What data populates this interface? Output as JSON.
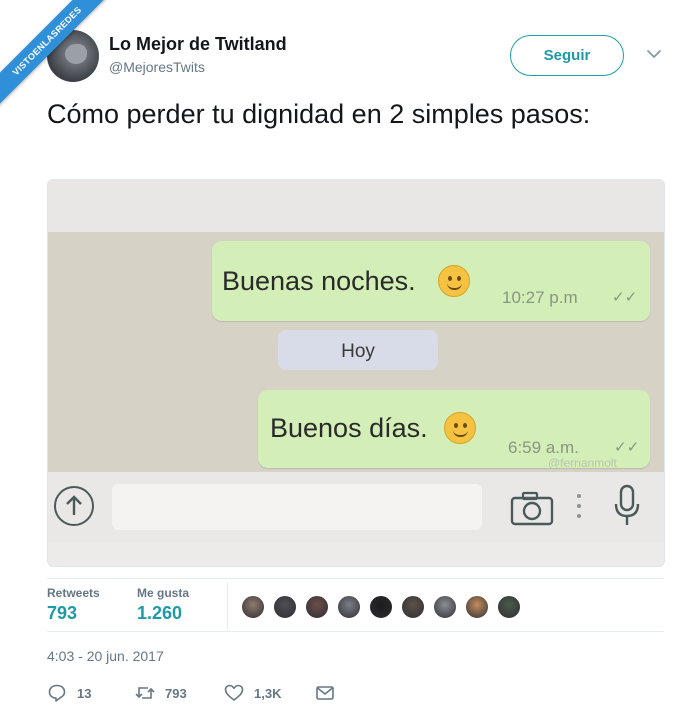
{
  "ribbon": {
    "text": "VISTOENLASREDES"
  },
  "header": {
    "name": "Lo Mejor de Twitland",
    "handle": "@MejoresTwits",
    "follow_label": "Seguir"
  },
  "tweet": {
    "text": "Cómo perder tu dignidad en 2 simples pasos:"
  },
  "media": {
    "message_1": {
      "text": "Buenas noches.",
      "time": "10:27 p.m"
    },
    "date_pill": "Hoy",
    "message_2": {
      "text": "Buenos días.",
      "time": "6:59 a.m."
    },
    "watermark": "@fernanmolt"
  },
  "stats": {
    "retweets_label": "Retweets",
    "retweets_value": "793",
    "likes_label": "Me gusta",
    "likes_value": "1.260",
    "liker_colors": [
      "#8f7a6a",
      "#4d4f55",
      "#6b4f4a",
      "#7a7f86",
      "#1c1c1e",
      "#5c5247",
      "#8b8f95",
      "#c38d5e",
      "#4a5a4a"
    ]
  },
  "timestamp": "4:03 - 20 jun. 2017",
  "actions": {
    "replies": "13",
    "retweets": "793",
    "likes": "1,3K"
  },
  "colors": {
    "accent": "#1d9aa6",
    "bubble": "#d3efb7",
    "ribbon": "#2f8fd8"
  }
}
